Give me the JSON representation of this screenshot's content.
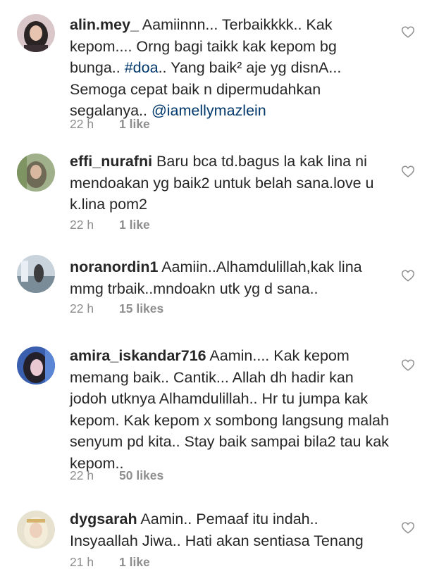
{
  "comments": [
    {
      "username": "alin.mey_",
      "text_a": " Aamiinnn... Terbaikkkk.. Kak kepom.... Orng bagi taikk kak kepom bg bunga.. ",
      "hashtag": "#doa",
      "text_b": ".. Yang baik² aje yg disnA... Semoga cepat baik n dipermudahkan segalanya.. ",
      "mention": "@iamellymazlein",
      "time": "22 h",
      "likes": "1 like"
    },
    {
      "username": "effi_nurafni",
      "text": " Baru bca td.bagus la kak lina ni mendoakan yg baik2 untuk belah sana.love u k.lina pom2",
      "time": "22 h",
      "likes": "1 like"
    },
    {
      "username": "noranordin1",
      "text": " Aamiin..Alhamdulillah,kak lina mmg trbaik..mndoakn utk yg d sana..",
      "time": "22 h",
      "likes": "15 likes"
    },
    {
      "username": "amira_iskandar716",
      "text": " Aamin.... Kak kepom memang baik.. Cantik... Allah dh hadir kan jodoh utknya Alhamdulillah.. Hr tu jumpa kak kepom. Kak kepom x sombong langsung malah senyum pd kita.. Stay baik sampai bila2 tau kak kepom..",
      "time": "22 h",
      "likes": "50 likes"
    },
    {
      "username": "dygsarah",
      "text": " Aamin.. Pemaaf itu indah.. Insyaallah Jiwa.. Hati akan sentiasa Tenang",
      "time": "21 h",
      "likes": "1 like"
    }
  ],
  "icons": {
    "avatar": "avatar-photo",
    "like": "heart-outline-icon"
  },
  "colors": {
    "text": "#262626",
    "meta": "#8e8e8e",
    "link": "#00376b"
  }
}
